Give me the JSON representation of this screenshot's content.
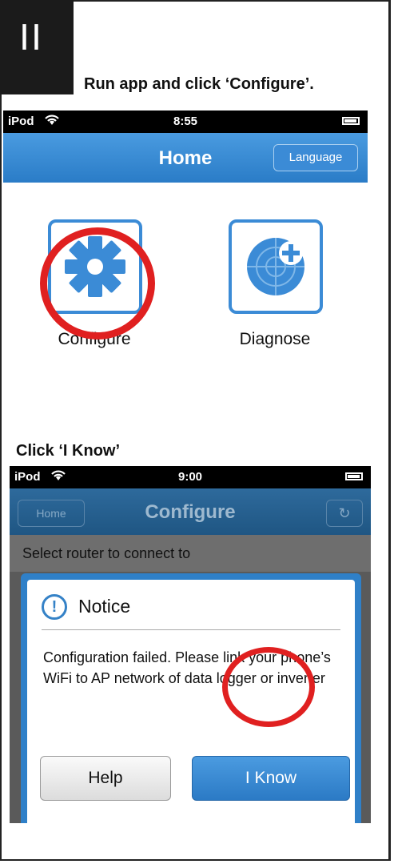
{
  "step": {
    "roman": "II",
    "instruction": "Run app and click ‘Configure’.",
    "instruction2": "Click ‘I Know’"
  },
  "screen1": {
    "status": {
      "carrier": "iPod",
      "time": "8:55"
    },
    "nav_title": "Home",
    "language_label": "Language",
    "tiles": [
      {
        "label": "Configure",
        "icon": "gear-icon"
      },
      {
        "label": "Diagnose",
        "icon": "radar-plus-icon"
      }
    ]
  },
  "screen2": {
    "status": {
      "carrier": "iPod",
      "time": "9:00"
    },
    "nav_title": "Configure",
    "home_label": "Home",
    "refresh_icon": "↻",
    "select_text": "Select router to connect to",
    "dialog": {
      "icon_glyph": "!",
      "title": "Notice",
      "message": "Configuration failed. Please link your phone’s WiFi to AP network of data logger or inverter",
      "help_label": "Help",
      "iknow_label": "I Know"
    }
  },
  "colors": {
    "accent": "#3b8bd6",
    "highlight": "#e02020"
  }
}
